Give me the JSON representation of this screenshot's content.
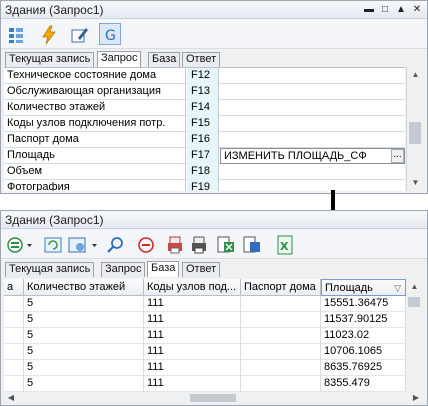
{
  "window1": {
    "title": "Здания (Запрос1)",
    "tabs": [
      "Текущая запись",
      "Запрос",
      "База",
      "Ответ"
    ],
    "rows": [
      {
        "name": "Техническое состояние дома",
        "field": "F12",
        "expr": ""
      },
      {
        "name": "Обслуживающая организация",
        "field": "F13",
        "expr": ""
      },
      {
        "name": "Количество этажей",
        "field": "F14",
        "expr": ""
      },
      {
        "name": "Коды узлов подключения потр.",
        "field": "F15",
        "expr": ""
      },
      {
        "name": "Паспорт дома",
        "field": "F16",
        "expr": ""
      },
      {
        "name": "Площадь",
        "field": "F17",
        "expr": "ИЗМЕНИТЬ ПЛОЩАДЬ_СФ"
      },
      {
        "name": "Объем",
        "field": "F18",
        "expr": ""
      },
      {
        "name": "Фотография",
        "field": "F19",
        "expr": ""
      }
    ],
    "ellipsis": "..."
  },
  "window2": {
    "title": "Здания (Запрос1)",
    "tabs": [
      "Текущая запись",
      "Запрос",
      "База",
      "Ответ"
    ],
    "columns": [
      "а",
      "Количество этажей",
      "Коды узлов под...",
      "Паспорт дома",
      "Площадь"
    ],
    "rows": [
      [
        "",
        "5",
        "111",
        "",
        "15551.36475"
      ],
      [
        "",
        "5",
        "111",
        "",
        "11537.90125"
      ],
      [
        "",
        "5",
        "111",
        "",
        "11023.02"
      ],
      [
        "",
        "5",
        "111",
        "",
        "10706.1065"
      ],
      [
        "",
        "5",
        "111",
        "",
        "8635.76925"
      ],
      [
        "",
        "5",
        "111",
        "",
        "8355.479"
      ]
    ]
  },
  "icons": {
    "titlebar": [
      "minimize-icon",
      "maximize-icon",
      "collapse-up-icon",
      "close-icon"
    ]
  }
}
